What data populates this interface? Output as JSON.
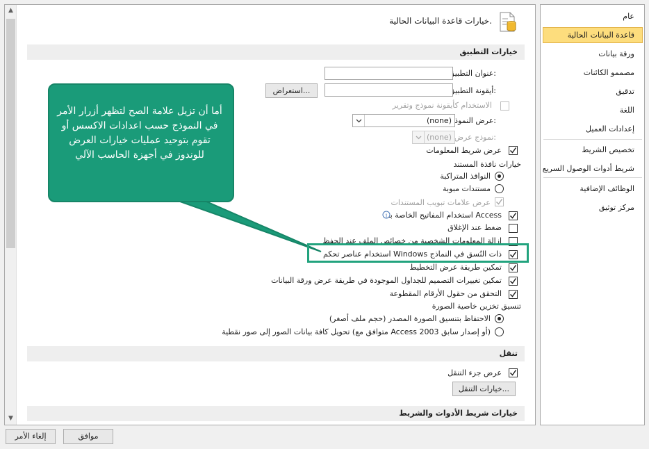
{
  "sidebar": {
    "items": [
      {
        "label": "عام"
      },
      {
        "label": "قاعدة البيانات الحالية"
      },
      {
        "label": "ورقة بيانات"
      },
      {
        "label": "مصممو الكائنات"
      },
      {
        "label": "تدقيق"
      },
      {
        "label": "اللغة"
      },
      {
        "label": "إعدادات العميل"
      },
      {
        "label": "تخصيص الشريط"
      },
      {
        "label": "شريط أدوات الوصول السريع"
      },
      {
        "label": "الوظائف الإضافية"
      },
      {
        "label": "مركز توثيق"
      }
    ],
    "selected": "قاعدة البيانات الحالية"
  },
  "header": {
    "title": "خيارات قاعدة البيانات الحالية."
  },
  "sections": {
    "app_options": "خيارات التطبيق",
    "navigation": "تنقل",
    "ribbon": "خيارات شريط الأدوات والشريط"
  },
  "app": {
    "app_title_label": "عنوان التطبيق:",
    "app_title_value": "",
    "app_icon_label": "أيقونة التطبيق:",
    "app_icon_value": "",
    "browse_button": "استعراض...",
    "use_as_form_icon": "الاستخدام كأيقونة نموذج وتقرير",
    "display_form_label": "عرض النموذج:",
    "display_form_value": "(none)",
    "web_display_form_label": "نموذج عرض ويب:",
    "web_display_form_value": "(none)",
    "display_status_bar": "عرض شريط المعلومات",
    "doc_window_options": "خيارات نافذة المستند",
    "overlapping_windows": "النوافذ المتراكبة",
    "tabbed_documents": "مستندات مبوبة",
    "display_doc_tabs": "عرض علامات تبويب المستندات",
    "use_access_keys": "استخدام المفاتيح الخاصة بـ Access",
    "compact_on_close": "ضغط عند الإغلاق",
    "remove_personal_info": "إزالة المعلومات الشخصية من خصائص الملف عند الحفظ",
    "use_windows_themed": "استخدام عناصر تحكم Windows ذات النُسق في النماذج",
    "enable_layout_view": "تمكين طريقة عرض التخطيط",
    "enable_design_changes": "تمكين تغييرات التصميم للجداول الموجودة في طريقة عرض ورقة البيانات",
    "check_truncated": "التحقق من حقول الأرقام المقطوعة",
    "picture_storage": "تنسيق تخزين خاصية الصورة",
    "preserve_source": "الاحتفاظ بتنسيق الصورة المصدر (حجم ملف أصغر)",
    "convert_bitmap": "تحويل كافة بيانات الصور إلى صور نقطية (متوافق مع Access 2003 أو إصدار سابق)"
  },
  "navigation": {
    "display_pane": "عرض جزء التنقل",
    "options_button": "خيارات التنقل..."
  },
  "callout": {
    "text": "أما أن تزيل علامة الصح لتظهر أزرار الأمر في النموذج حسب اعدادات الاكسس أو تقوم بتوحيد عمليات خيارات العرض للوندوز في أجهزة الحاسب الآلي"
  },
  "footer": {
    "ok_button": "موافق",
    "cancel_button": "إلغاء الأمر"
  },
  "colors": {
    "selected_bg": "#fddd7d",
    "callout": "#1a9b79",
    "highlight_border": "#22a37e"
  }
}
